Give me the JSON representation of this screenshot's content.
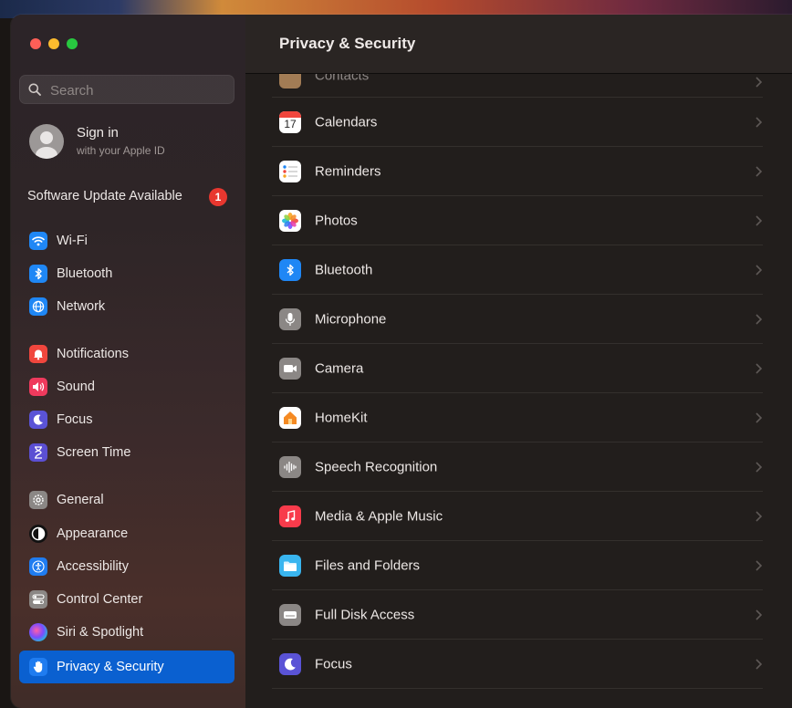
{
  "search": {
    "placeholder": "Search"
  },
  "account": {
    "title": "Sign in",
    "subtitle": "with your Apple ID"
  },
  "update": {
    "label": "Software Update Available",
    "badge": "1"
  },
  "sidebar": {
    "items": [
      {
        "label": "Wi-Fi",
        "icon": "wifi-icon"
      },
      {
        "label": "Bluetooth",
        "icon": "bluetooth-icon"
      },
      {
        "label": "Network",
        "icon": "globe-icon"
      },
      {
        "label": "Notifications",
        "icon": "bell-icon"
      },
      {
        "label": "Sound",
        "icon": "speaker-icon"
      },
      {
        "label": "Focus",
        "icon": "moon-icon"
      },
      {
        "label": "Screen Time",
        "icon": "hourglass-icon"
      },
      {
        "label": "General",
        "icon": "gear-icon"
      },
      {
        "label": "Appearance",
        "icon": "appearance-icon"
      },
      {
        "label": "Accessibility",
        "icon": "accessibility-icon"
      },
      {
        "label": "Control Center",
        "icon": "toggles-icon"
      },
      {
        "label": "Siri & Spotlight",
        "icon": "siri-icon"
      },
      {
        "label": "Privacy & Security",
        "icon": "hand-icon"
      }
    ],
    "selected": "Privacy & Security"
  },
  "main": {
    "title": "Privacy & Security",
    "calendar_day": "17",
    "rows": [
      {
        "label": "Contacts",
        "icon": "contacts-icon"
      },
      {
        "label": "Calendars",
        "icon": "calendar-icon"
      },
      {
        "label": "Reminders",
        "icon": "reminders-icon"
      },
      {
        "label": "Photos",
        "icon": "photos-icon"
      },
      {
        "label": "Bluetooth",
        "icon": "bluetooth-icon"
      },
      {
        "label": "Microphone",
        "icon": "microphone-icon"
      },
      {
        "label": "Camera",
        "icon": "camera-icon"
      },
      {
        "label": "HomeKit",
        "icon": "home-icon"
      },
      {
        "label": "Speech Recognition",
        "icon": "waveform-icon"
      },
      {
        "label": "Media & Apple Music",
        "icon": "music-note-icon"
      },
      {
        "label": "Files and Folders",
        "icon": "folder-icon"
      },
      {
        "label": "Full Disk Access",
        "icon": "disk-icon"
      },
      {
        "label": "Focus",
        "icon": "moon-icon"
      }
    ]
  },
  "colors": {
    "accent_selected": "#0a60d0",
    "badge_red": "#e8372f",
    "wifi_blue": "#1f87f5",
    "notification_red": "#f0463d",
    "sound_pink": "#ef3a5d",
    "focus_indigo": "#5a53d6",
    "screen_time_purple": "#5b4fd3",
    "music_red": "#f83b4b"
  }
}
